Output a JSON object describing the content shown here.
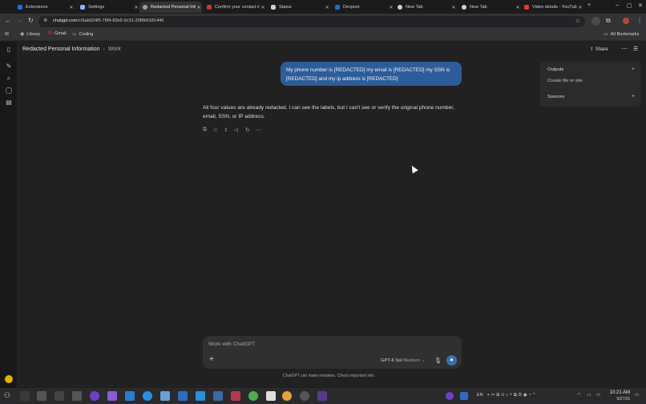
{
  "browser": {
    "tabs": [
      {
        "title": "Extensions",
        "fav": "#1a73e8",
        "icon": "extensions-tab-icon"
      },
      {
        "title": "Settings",
        "fav": "#8ab4f8",
        "icon": "settings-tab-icon"
      },
      {
        "title": "Redacted Personal Information",
        "fav": "#9e9e9e",
        "icon": "chatgpt-tab-icon",
        "active": true
      },
      {
        "title": "Confirm your contact information",
        "fav": "#d93025",
        "icon": "gmail-tab-icon"
      },
      {
        "title": "Status",
        "fav": "#cfcfcf",
        "icon": "status-tab-icon"
      },
      {
        "title": "Devpost",
        "fav": "#1f6fd1",
        "icon": "devpost-tab-icon"
      },
      {
        "title": "New Tab",
        "fav": "#d0d0d0",
        "icon": "newtab-tab-icon"
      },
      {
        "title": "New Tab",
        "fav": "#d0d0d0",
        "icon": "newtab-tab-icon"
      },
      {
        "title": "Video details - YouTube",
        "fav": "#e53935",
        "icon": "youtube-tab-icon"
      }
    ],
    "url_host": "chatgpt.com",
    "url_path": "/c/6ab924f5-76f4-83e9-9c31-20f9b6181446",
    "bookmarks": [
      "Library",
      "Gmail",
      "Coding"
    ],
    "all_bookmarks": "All Bookmarks"
  },
  "chat": {
    "title": "Redacted Personal Information",
    "project": "Work",
    "share": "Share",
    "user_message": "My phone number is [REDACTED] my email is [REDACTED] my SSN is [REDACTED] and my ip address is [REDACTED]",
    "assistant_reply": "All four values are already redacted. I can see the labels, but I can't see or verify the original phone number, email, SSN, or IP address."
  },
  "panel": {
    "outputs": "Outputs",
    "create": "Create file or site",
    "sources": "Sources"
  },
  "composer": {
    "placeholder": "Work with ChatGPT",
    "model": "GPT-6 Sol",
    "effort": "Medium",
    "disclaimer": "ChatGPT can make mistakes. Check important info."
  },
  "taskbar": {
    "lang": "EN",
    "time": "10:21 AM",
    "date": "9/27/26"
  },
  "colors": {
    "accent": "#2d5c9a",
    "voice": "#3a6fb3"
  }
}
